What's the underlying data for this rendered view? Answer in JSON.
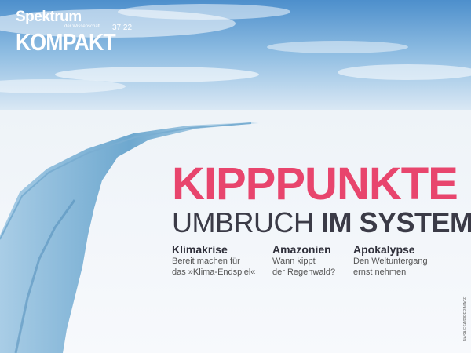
{
  "masthead": {
    "brand": "Spektrum",
    "brand_sub": "der Wissenschaft",
    "series": "KOMPAKT",
    "issue": "37.22"
  },
  "cover": {
    "headline": "KIPPPUNKTE",
    "subline_light": "UMBRUCH",
    "subline_bold": "IM SYSTEM"
  },
  "teasers": [
    {
      "title": "Klimakrise",
      "text_line1": "Bereit machen für",
      "text_line2": "das »Klima-Endspiel«"
    },
    {
      "title": "Amazonien",
      "text_line1": "Wann kippt",
      "text_line2": "der Regenwald?"
    },
    {
      "title": "Apokalypse",
      "text_line1": "Den Weltuntergang",
      "text_line2": "ernst nehmen"
    }
  ],
  "credit": "NASA/ESA/PIPERIMAGE",
  "colors": {
    "headline": "#e8456d",
    "dark_text": "#3b3b47",
    "sky": "#5f9bd0",
    "ice": "#f3f6fb"
  }
}
